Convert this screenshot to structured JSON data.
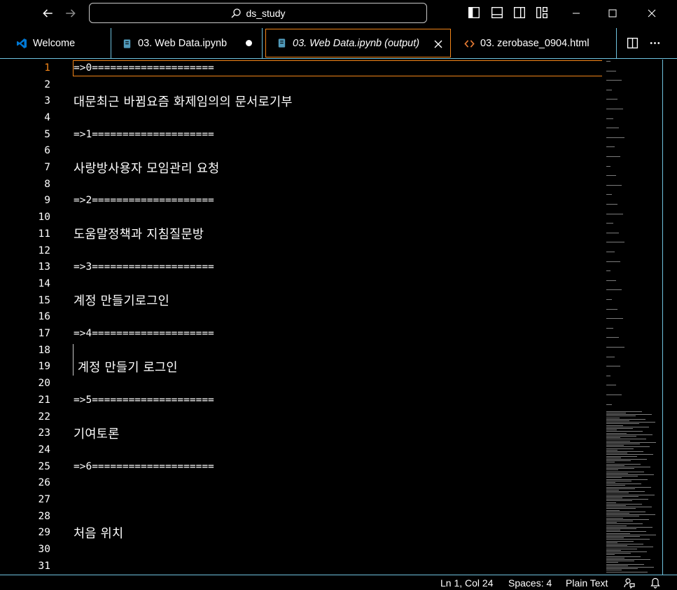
{
  "titlebar": {
    "search_text": "ds_study",
    "icons": [
      "arrow-left-icon",
      "arrow-right-icon",
      "search-icon",
      "toggle-primary-sidebar-icon",
      "toggle-panel-icon",
      "toggle-secondary-sidebar-icon",
      "customize-layout-icon",
      "minimize-icon",
      "maximize-icon",
      "close-icon"
    ]
  },
  "tabs": [
    {
      "label": "Welcome",
      "icon": "vscode-logo-icon",
      "state": "inactive"
    },
    {
      "label": "03. Web Data.ipynb",
      "icon": "notebook-icon",
      "state": "dirty"
    },
    {
      "label": "03. Web Data.ipynb (output)",
      "icon": "notebook-icon",
      "state": "active"
    },
    {
      "label": "03. zerobase_0904.html",
      "icon": "html-brackets-icon",
      "state": "inactive"
    }
  ],
  "tab_actions": [
    "split-editor-icon",
    "more-actions-icon"
  ],
  "editor": {
    "current_line": 1,
    "lines": [
      {
        "n": "1",
        "text": "=>0===================="
      },
      {
        "n": "2",
        "text": ""
      },
      {
        "n": "3",
        "text": "대문최근 바뀜요즘 화제임의의 문서로기부"
      },
      {
        "n": "4",
        "text": ""
      },
      {
        "n": "5",
        "text": "=>1===================="
      },
      {
        "n": "6",
        "text": ""
      },
      {
        "n": "7",
        "text": "사랑방사용자 모임관리 요청"
      },
      {
        "n": "8",
        "text": ""
      },
      {
        "n": "9",
        "text": "=>2===================="
      },
      {
        "n": "10",
        "text": ""
      },
      {
        "n": "11",
        "text": "도움말정책과 지침질문방"
      },
      {
        "n": "12",
        "text": ""
      },
      {
        "n": "13",
        "text": "=>3===================="
      },
      {
        "n": "14",
        "text": ""
      },
      {
        "n": "15",
        "text": "계정 만들기로그인"
      },
      {
        "n": "16",
        "text": ""
      },
      {
        "n": "17",
        "text": "=>4===================="
      },
      {
        "n": "18",
        "text": ""
      },
      {
        "n": "19",
        "text": " 계정 만들기 로그인"
      },
      {
        "n": "20",
        "text": ""
      },
      {
        "n": "21",
        "text": "=>5===================="
      },
      {
        "n": "22",
        "text": ""
      },
      {
        "n": "23",
        "text": "기여토론"
      },
      {
        "n": "24",
        "text": ""
      },
      {
        "n": "25",
        "text": "=>6===================="
      },
      {
        "n": "26",
        "text": ""
      },
      {
        "n": "27",
        "text": ""
      },
      {
        "n": "28",
        "text": ""
      },
      {
        "n": "29",
        "text": "처음 위치"
      },
      {
        "n": "30",
        "text": ""
      },
      {
        "n": "31",
        "text": ""
      }
    ]
  },
  "statusbar": {
    "position": "Ln 1, Col 24",
    "indent": "Spaces: 4",
    "language": "Plain Text",
    "icons": [
      "feedback-icon",
      "notifications-bell-icon"
    ]
  },
  "colors": {
    "accent_border": "#6fc3df",
    "active_highlight": "#f38518",
    "vscode_blue": "#0078d4",
    "notebook_icon": "#519aba",
    "html_icon": "#e37933"
  }
}
